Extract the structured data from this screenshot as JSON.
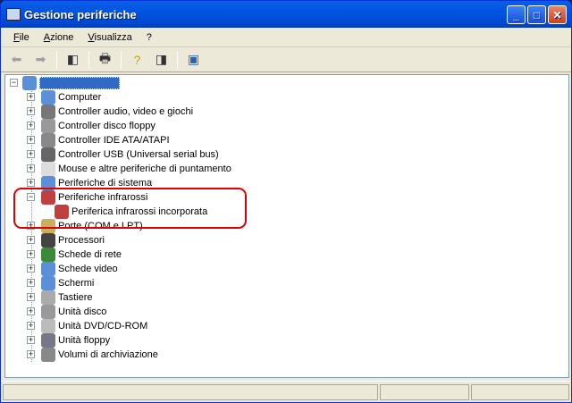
{
  "window": {
    "title": "Gestione periferiche"
  },
  "menu": [
    {
      "label": "File",
      "key": "F",
      "rest": "ile"
    },
    {
      "label": "Azione",
      "key": "A",
      "rest": "zione"
    },
    {
      "label": "Visualizza",
      "key": "V",
      "rest": "isualizza"
    },
    {
      "label": "?",
      "key": "?",
      "rest": ""
    }
  ],
  "toolbar": [
    "back-icon",
    "forward-icon",
    "show-hide-tree-icon",
    "print-icon",
    "properties-help-icon",
    "show-hide-action-pane-icon",
    "scan-hardware-icon"
  ],
  "tree": {
    "root": "",
    "items": [
      {
        "label": "Computer",
        "color": "#5b8fd8"
      },
      {
        "label": "Controller audio, video e giochi",
        "color": "#777"
      },
      {
        "label": "Controller disco floppy",
        "color": "#999"
      },
      {
        "label": "Controller IDE ATA/ATAPI",
        "color": "#888"
      },
      {
        "label": "Controller USB (Universal serial bus)",
        "color": "#666"
      },
      {
        "label": "Mouse e altre periferiche di puntamento",
        "color": "#ddd"
      },
      {
        "label": "Periferiche di sistema",
        "color": "#5b8fd8"
      },
      {
        "label": "Periferiche infrarossi",
        "color": "#c04040",
        "expanded": true
      },
      {
        "label": "Periferica infrarossi incorporata",
        "color": "#c04040",
        "child": true
      },
      {
        "label": "Porte (COM e LPT)",
        "color": "#c8b060"
      },
      {
        "label": "Processori",
        "color": "#444"
      },
      {
        "label": "Schede di rete",
        "color": "#3a8a3a"
      },
      {
        "label": "Schede video",
        "color": "#5b8fd8"
      },
      {
        "label": "Schermi",
        "color": "#5b8fd8"
      },
      {
        "label": "Tastiere",
        "color": "#aaa"
      },
      {
        "label": "Unità disco",
        "color": "#999"
      },
      {
        "label": "Unità DVD/CD-ROM",
        "color": "#bbb"
      },
      {
        "label": "Unità floppy",
        "color": "#778"
      },
      {
        "label": "Volumi di archiviazione",
        "color": "#888"
      }
    ]
  }
}
